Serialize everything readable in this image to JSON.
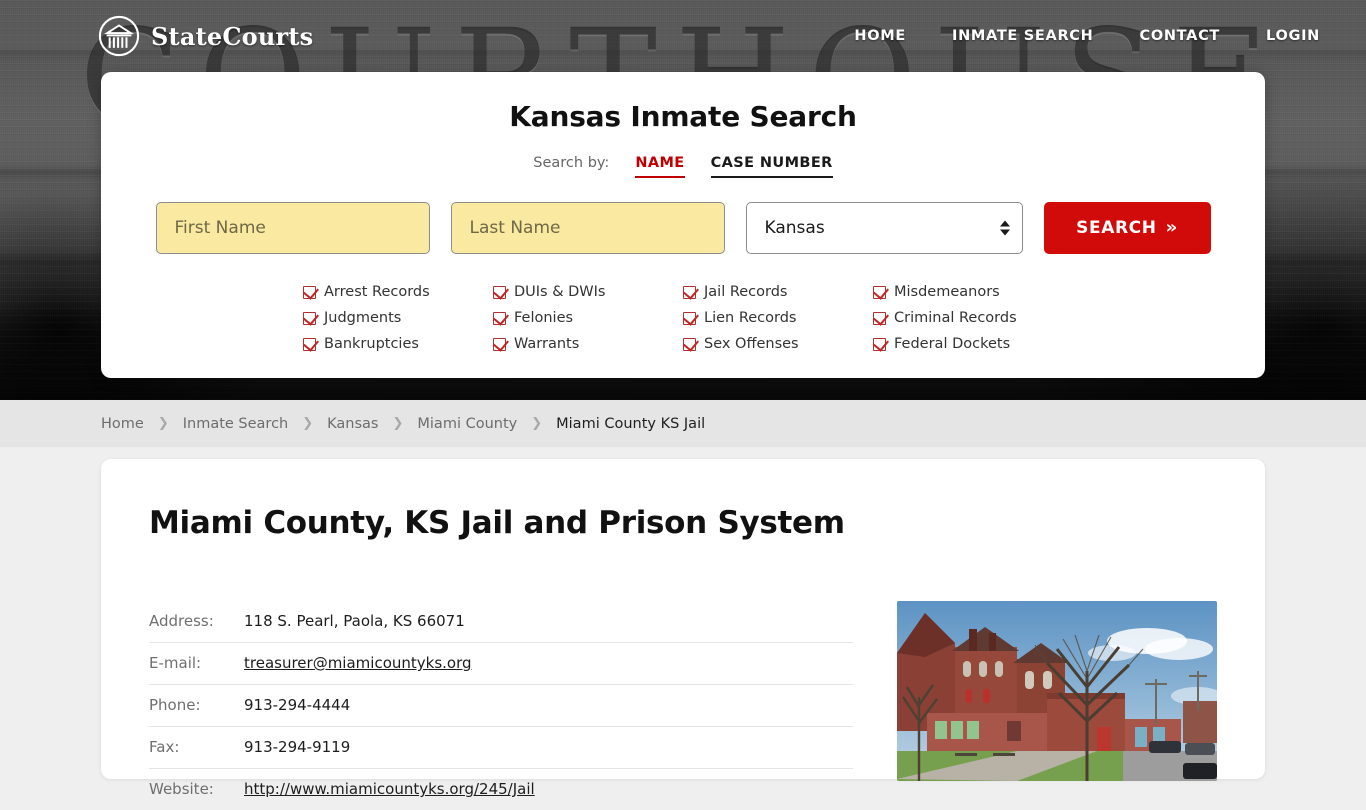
{
  "site": {
    "brand_name": "StateCourts",
    "logo_icon": "courthouse-circle-icon",
    "hero_watermark_text": "COURTHOUSE"
  },
  "nav": {
    "items": [
      {
        "label": "HOME"
      },
      {
        "label": "INMATE SEARCH"
      },
      {
        "label": "CONTACT"
      },
      {
        "label": "LOGIN"
      }
    ]
  },
  "search_card": {
    "title": "Kansas Inmate Search",
    "search_by_label": "Search by:",
    "tabs": [
      {
        "label": "NAME",
        "active": true
      },
      {
        "label": "CASE NUMBER",
        "active": false
      }
    ],
    "first_name": {
      "placeholder": "First Name",
      "value": ""
    },
    "last_name": {
      "placeholder": "Last Name",
      "value": ""
    },
    "state_select": {
      "value": "Kansas"
    },
    "submit_label": "SEARCH",
    "submit_chevron": "»",
    "accent_red": "#d10a0a",
    "input_background": "#fae9a0",
    "record_types": [
      "Arrest Records",
      "Judgments",
      "Bankruptcies",
      "DUIs & DWIs",
      "Felonies",
      "Warrants",
      "Jail Records",
      "Lien Records",
      "Sex Offenses",
      "Misdemeanors",
      "Criminal Records",
      "Federal Dockets"
    ]
  },
  "breadcrumb": {
    "separator": "❯",
    "items": [
      {
        "label": "Home",
        "current": false
      },
      {
        "label": "Inmate Search",
        "current": false
      },
      {
        "label": "Kansas",
        "current": false
      },
      {
        "label": "Miami County",
        "current": false
      },
      {
        "label": "Miami County KS Jail",
        "current": true
      }
    ]
  },
  "page": {
    "title": "Miami County, KS Jail and Prison System",
    "details": [
      {
        "key": "Address:",
        "value": "118 S. Pearl, Paola, KS 66071",
        "link": false
      },
      {
        "key": "E-mail:",
        "value": "treasurer@miamicountyks.org",
        "link": true
      },
      {
        "key": "Phone:",
        "value": "913-294-4444",
        "link": false
      },
      {
        "key": "Fax:",
        "value": "913-294-9119",
        "link": false
      },
      {
        "key": "Website:",
        "value": "http://www.miamicountyks.org/245/Jail",
        "link": true
      }
    ],
    "photo_alt": "miami-county-courthouse-photo"
  }
}
